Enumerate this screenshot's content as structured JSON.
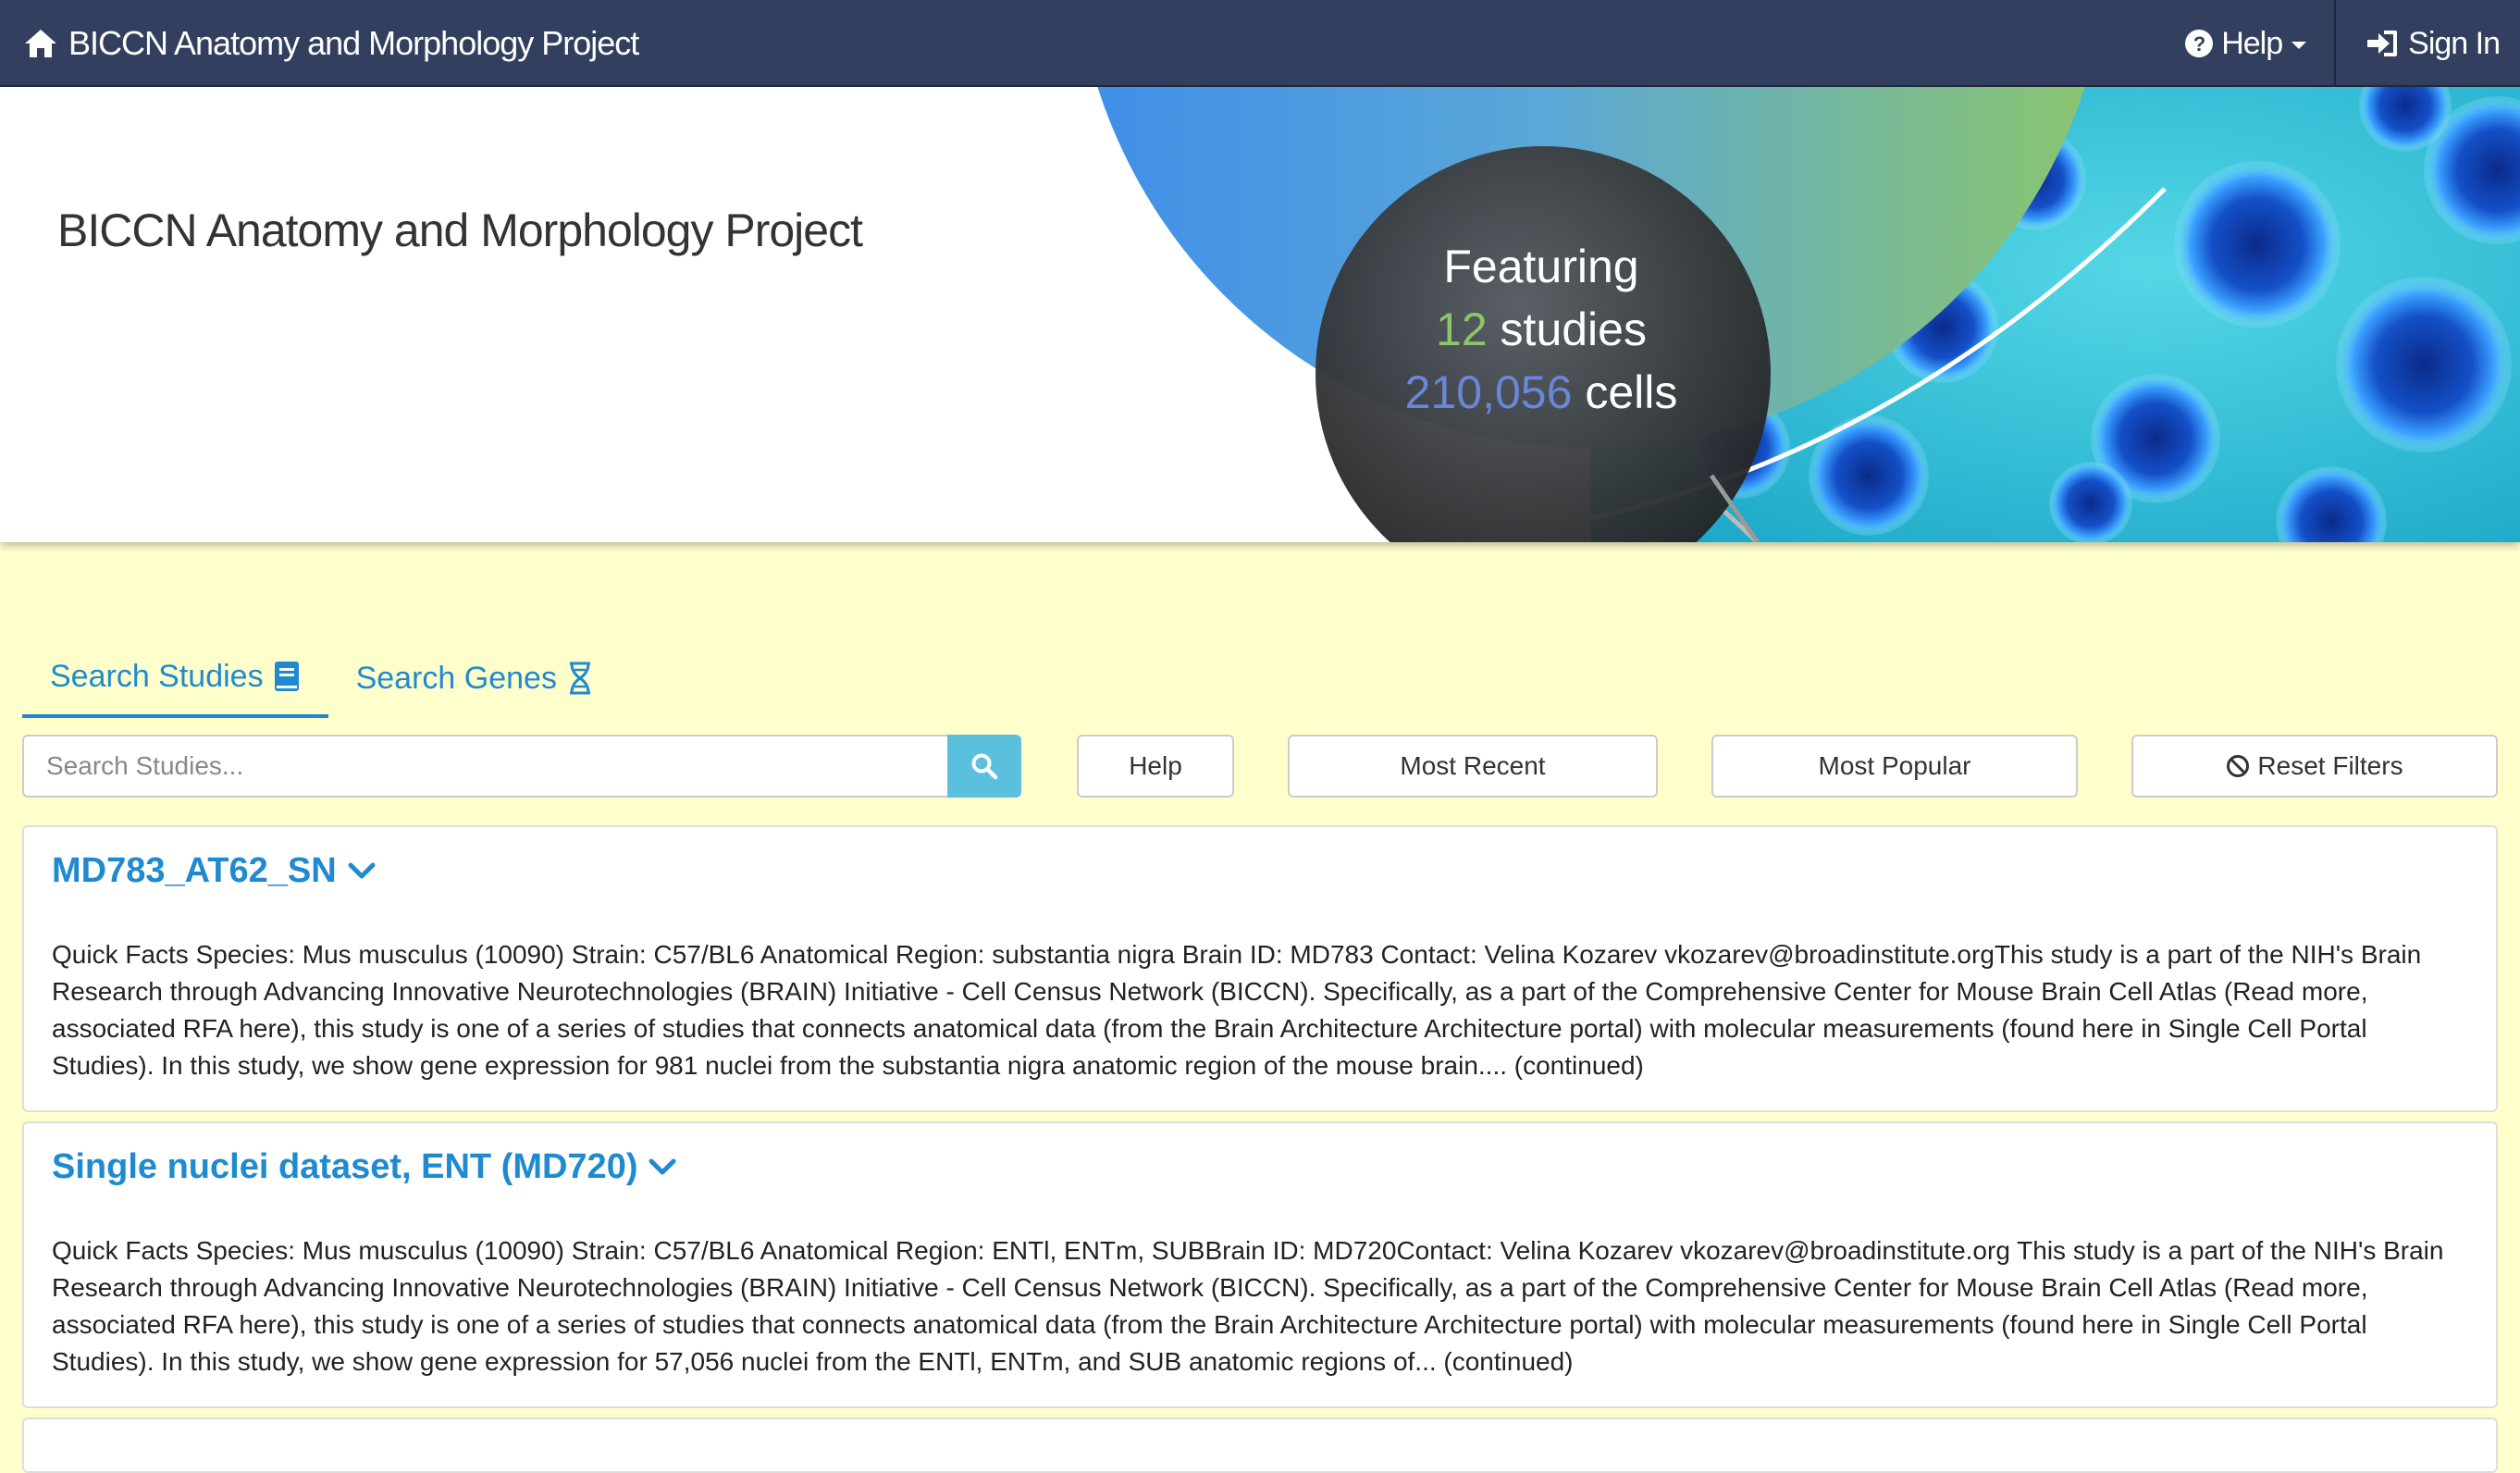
{
  "navbar": {
    "brand_title": "BICCN Anatomy and Morphology Project",
    "help_label": "Help",
    "signin_label": "Sign In"
  },
  "hero": {
    "title": "BICCN Anatomy and Morphology Project",
    "featuring_label": "Featuring",
    "studies_count": "12",
    "studies_label": "studies",
    "cells_count": "210,056",
    "cells_label": "cells"
  },
  "tabs": [
    {
      "label": "Search Studies",
      "icon": "book-icon",
      "active": true
    },
    {
      "label": "Search Genes",
      "icon": "dna-icon",
      "active": false
    }
  ],
  "search": {
    "placeholder": "Search Studies...",
    "value": "",
    "help_label": "Help",
    "most_recent_label": "Most Recent",
    "most_popular_label": "Most Popular",
    "reset_label": "Reset Filters"
  },
  "studies": [
    {
      "title": "MD783_AT62_SN",
      "description": "Quick Facts Species: Mus musculus (10090) Strain: C57/BL6 Anatomical Region: substantia nigra Brain ID: MD783 Contact: Velina Kozarev vkozarev@broadinstitute.orgThis study is a part of the NIH's Brain Research through Advancing Innovative Neurotechnologies (BRAIN) Initiative - Cell Census Network (BICCN). Specifically, as a part of the Comprehensive Center for Mouse Brain Cell Atlas (Read more, associated RFA here), this study is one of a series of studies that connects anatomical data (from the Brain Architecture Architecture portal) with molecular measurements (found here in Single Cell Portal Studies). In this study, we show gene expression for 981 nuclei from the substantia nigra anatomic region of the mouse brain.... (continued)"
    },
    {
      "title": "Single nuclei dataset, ENT (MD720)",
      "description": "Quick Facts Species: Mus musculus (10090) Strain: C57/BL6 Anatomical Region: ENTl, ENTm, SUBBrain ID: MD720Contact: Velina Kozarev vkozarev@broadinstitute.org This study is a part of the NIH's Brain Research through Advancing Innovative Neurotechnologies (BRAIN) Initiative - Cell Census Network (BICCN). Specifically, as a part of the Comprehensive Center for Mouse Brain Cell Atlas (Read more, associated RFA here), this study is one of a series of studies that connects anatomical data (from the Brain Architecture Architecture portal) with molecular measurements (found here in Single Cell Portal Studies). In this study, we show gene expression for 57,056 nuclei from the ENTl, ENTm, and SUB anatomic regions of... (continued)"
    }
  ],
  "colors": {
    "navbar_bg": "#333f5e",
    "page_bg": "#ffffcc",
    "link_blue": "#1f8ad0",
    "search_button": "#5bc0de",
    "studies_count_green": "#8cc66b",
    "cells_count_blue": "#6a86d8"
  }
}
